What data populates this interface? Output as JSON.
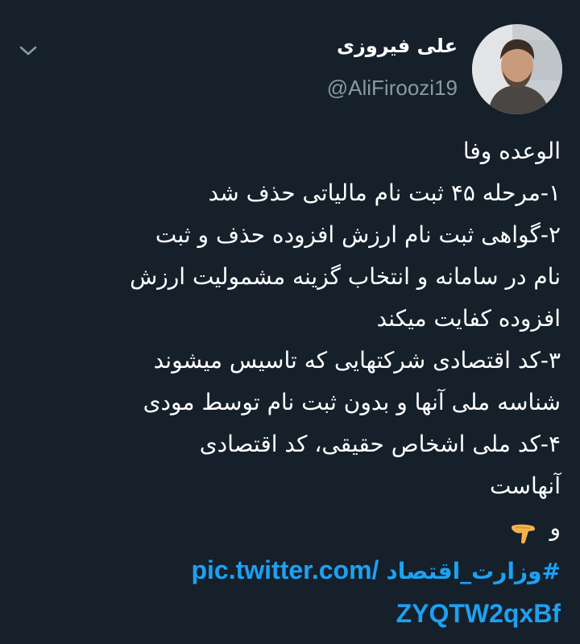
{
  "tweet": {
    "display_name": "علی فیروزی",
    "handle": "@AliFiroozi19",
    "lines": [
      "الوعده وفا",
      "۱-مرحله ۴۵ ثبت نام مالیاتی حذف شد",
      "۲-گواهی ثبت نام ارزش افزوده حذف و ثبت",
      "نام در سامانه و انتخاب گزینه مشمولیت ارزش",
      "افزوده کفایت میکند",
      "۳-کد اقتصادی شرکتهایی که تاسیس میشوند",
      "شناسه ملی آنها و بدون ثبت نام توسط مودی",
      "۴-کد ملی اشخاص حقیقی، کد اقتصادی",
      "آنهاست"
    ],
    "last_word": "و",
    "hashtag": "#وزارت_اقتصاد",
    "link_part1": "pic.twitter.com/",
    "link_part2": "ZYQTW2qxBf",
    "accent_color": "#1da1f2",
    "background_color": "#15202b"
  },
  "icons": {
    "menu": "chevron-down-icon",
    "emoji": "backhand-index-pointing-down-icon"
  }
}
